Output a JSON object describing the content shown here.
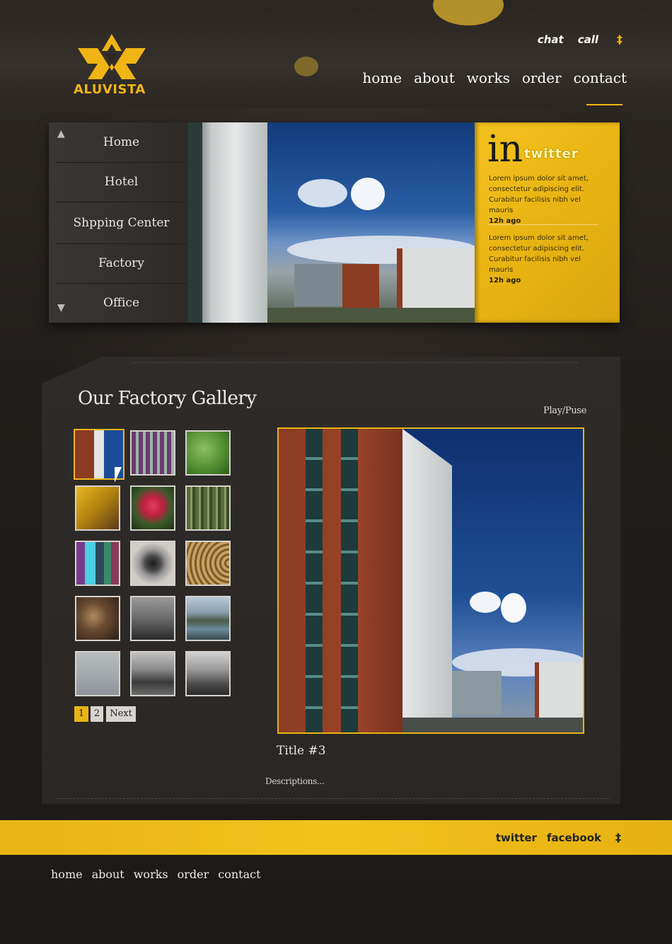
{
  "brand": {
    "name": "ALUVISTA",
    "logo_icon": "aluvista-logo-icon",
    "accent_color": "#f0b514"
  },
  "top_links": {
    "chat": "chat",
    "call": "call",
    "rss_icon": "rss-icon"
  },
  "main_nav": [
    "home",
    "about",
    "works",
    "order",
    "contact"
  ],
  "side_menu": [
    "Home",
    "Hotel",
    "Shpping Center",
    "Factory",
    "Office"
  ],
  "twitter": {
    "in_label": "in",
    "brand_label": "twitter",
    "tweets": [
      {
        "text": "Lorem ipsum dolor sit amet, consectetur adipiscing elit. Curabitur facilisis nibh vel mauris",
        "time": "12h ago"
      },
      {
        "text": "Lorem ipsum dolor sit amet, consectetur adipiscing elit. Curabitur facilisis nibh vel mauris",
        "time": "12h ago"
      }
    ]
  },
  "gallery": {
    "title": "Our Factory Gallery",
    "play_pause": "Play/Puse",
    "pagination": {
      "page1": "1",
      "page2": "2",
      "next": "Next"
    },
    "image_title": "Title #3",
    "description": "Descriptions..."
  },
  "footer_band": {
    "twitter": "twitter",
    "facebook": "facebook"
  },
  "footer_nav": [
    "home",
    "about",
    "works",
    "order",
    "contact"
  ]
}
